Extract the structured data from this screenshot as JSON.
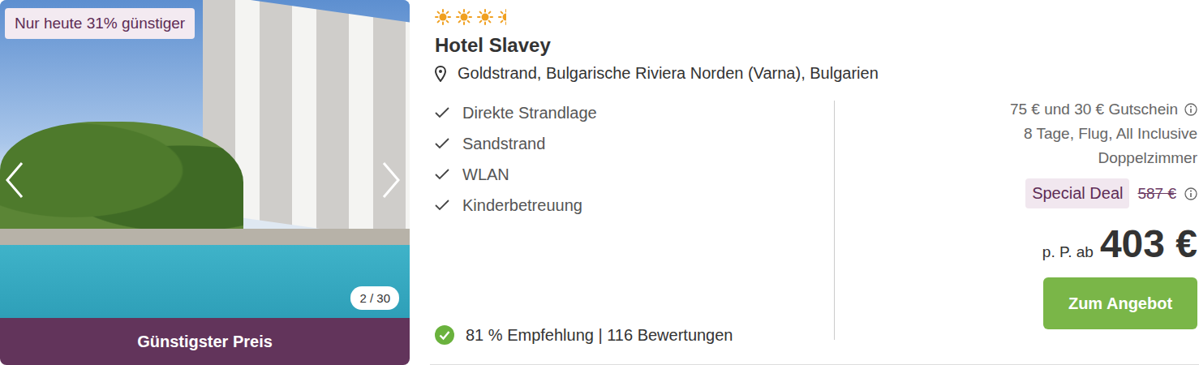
{
  "gallery": {
    "badge": "Nur heute 31% günstiger",
    "counter": "2 / 30",
    "footer": "Günstigster Preis"
  },
  "hotel": {
    "stars": 3.5,
    "name": "Hotel Slavey",
    "location": "Goldstrand, Bulgarische Riviera Norden (Varna), Bulgarien"
  },
  "features": [
    "Direkte Strandlage",
    "Sandstrand",
    "WLAN",
    "Kinderbetreuung"
  ],
  "rating": {
    "text": "81 % Empfehlung | 116 Bewertungen"
  },
  "offer": {
    "voucher": "75 € und 30 € Gutschein",
    "details": "8 Tage, Flug, All Inclusive",
    "room": "Doppelzimmer",
    "deal": "Special Deal",
    "old_price": "587 €",
    "price_prefix": "p. P. ab",
    "price": "403 €",
    "button": "Zum Angebot"
  }
}
